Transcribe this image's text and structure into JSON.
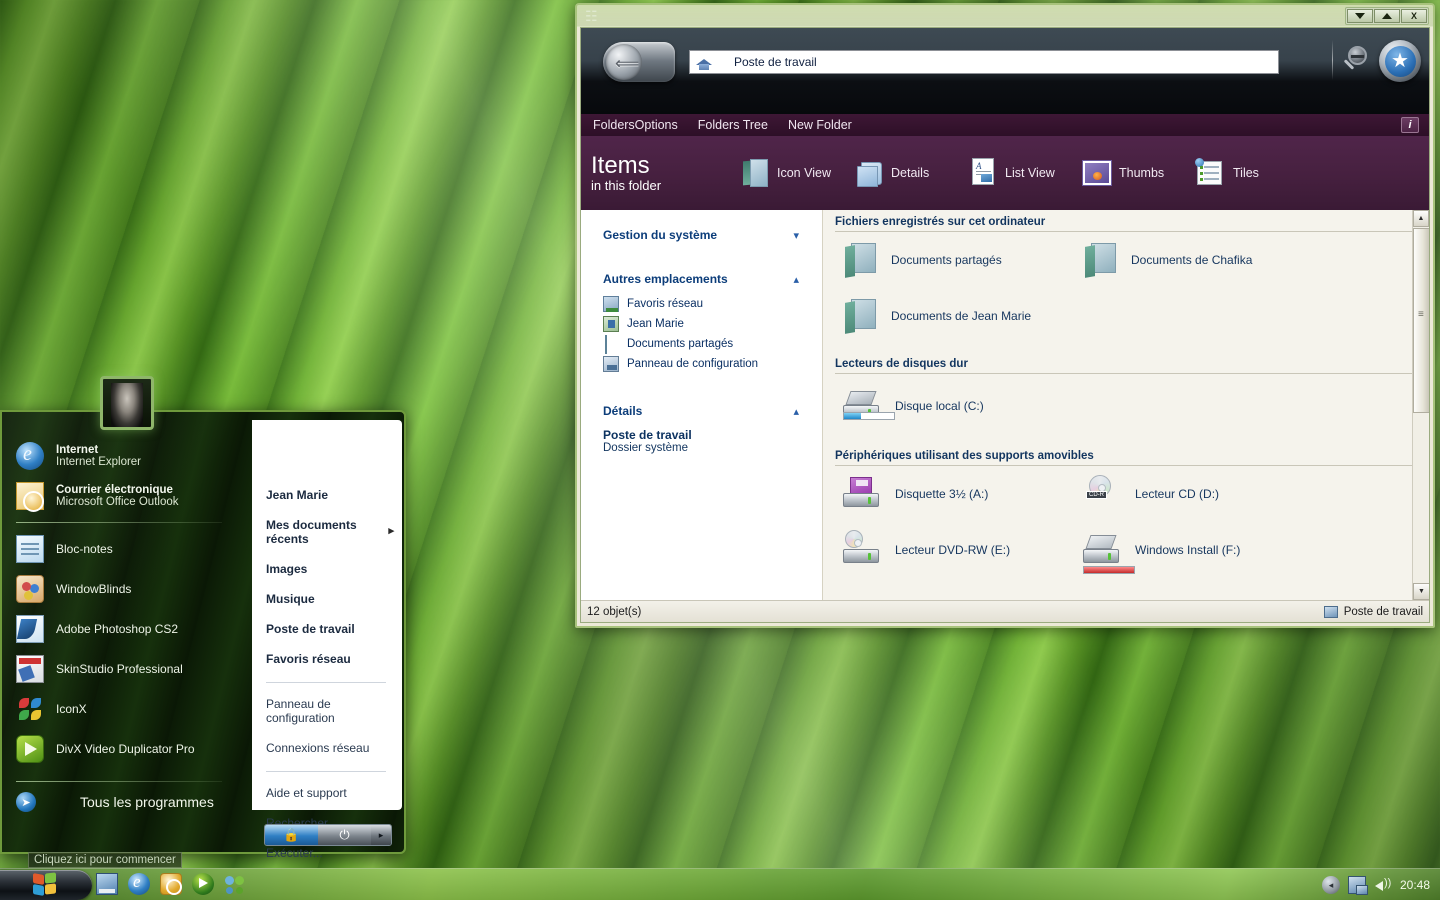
{
  "desktop": {
    "wallpaper_name": "green-grass-blades"
  },
  "explorer": {
    "window_icon": "windows-logo-icon",
    "title_buttons": [
      {
        "name": "minimize",
        "glyph": "▼"
      },
      {
        "name": "maximize",
        "glyph": "▲"
      },
      {
        "name": "close",
        "glyph": "X"
      }
    ],
    "nav": {
      "back_label": "←",
      "back_icon": "back-arrow-icon",
      "address_icon": "home-icon",
      "address_value": "Poste de travail",
      "address_placeholder": "Poste de travail",
      "search_icon": "magnifier-icon",
      "favorites_icon": "star-icon"
    },
    "menubar": {
      "items": [
        "FoldersOptions",
        "Folders Tree",
        "New Folder"
      ],
      "info_label": "i"
    },
    "viewbar": {
      "title_main": "Items",
      "title_sub": "in this folder",
      "views": [
        {
          "label": "Icon View",
          "icon": "open-folder-icon"
        },
        {
          "label": "Details",
          "icon": "folder-stack-icon"
        },
        {
          "label": "List View",
          "icon": "document-list-icon"
        },
        {
          "label": "Thumbs",
          "icon": "thumbnail-photo-icon"
        },
        {
          "label": "Tiles",
          "icon": "tiles-list-icon"
        }
      ]
    },
    "sidebar": {
      "groups": [
        {
          "title": "Gestion du système",
          "chevron": "▾",
          "expanded": false,
          "items": []
        },
        {
          "title": "Autres emplacements",
          "chevron": "▴",
          "expanded": true,
          "items": [
            {
              "label": "Favoris réseau",
              "icon": "network-places-icon"
            },
            {
              "label": "Jean Marie",
              "icon": "user-folder-icon"
            },
            {
              "label": "Documents partagés",
              "icon": "shared-documents-icon"
            },
            {
              "label": "Panneau de configuration",
              "icon": "control-panel-icon"
            }
          ]
        }
      ],
      "details": {
        "title": "Détails",
        "chevron": "▴",
        "name": "Poste de travail",
        "type": "Dossier système"
      }
    },
    "sections": [
      {
        "title": "Fichiers enregistrés sur cet ordinateur",
        "items": [
          {
            "label": "Documents partagés",
            "icon": "folder-icon"
          },
          {
            "label": "Documents de Chafika",
            "icon": "folder-icon"
          },
          {
            "label": "Documents de Jean Marie",
            "icon": "folder-icon"
          }
        ]
      },
      {
        "title": "Lecteurs de disques dur",
        "items": [
          {
            "label": "Disque local (C:)",
            "icon": "hard-drive-icon",
            "capacity_percent": 34,
            "capacity_color": "#1f87c9"
          }
        ]
      },
      {
        "title": "Périphériques utilisant des supports amovibles",
        "items": [
          {
            "label": "Disquette 3½ (A:)",
            "icon": "floppy-drive-icon"
          },
          {
            "label": "Lecteur CD (D:)",
            "icon": "cd-drive-icon",
            "badge": "CD-R"
          },
          {
            "label": "Lecteur DVD-RW (E:)",
            "icon": "dvd-drive-icon"
          },
          {
            "label": "Windows Install (F:)",
            "icon": "removable-drive-icon",
            "capacity_percent": 100,
            "capacity_color": "#c42b2b"
          }
        ]
      }
    ],
    "scrollbar": {
      "up_glyph": "▲",
      "down_glyph": "▼",
      "grip": "≡"
    },
    "statusbar": {
      "count_text": "12 objet(s)",
      "location_text": "Poste de travail",
      "location_icon": "computer-icon"
    }
  },
  "start_menu": {
    "avatar_name": "user-avatar",
    "programs": [
      {
        "title": "Internet",
        "subtitle": "Internet Explorer",
        "icon": "internet-explorer-icon"
      },
      {
        "title": "Courrier électronique",
        "subtitle": "Microsoft Office Outlook",
        "icon": "outlook-icon"
      }
    ],
    "pinned": [
      {
        "label": "Bloc-notes",
        "icon": "notepad-icon"
      },
      {
        "label": "WindowBlinds",
        "icon": "windowblinds-icon"
      },
      {
        "label": "Adobe Photoshop CS2",
        "icon": "photoshop-icon"
      },
      {
        "label": "SkinStudio Professional",
        "icon": "skinstudio-icon"
      },
      {
        "label": "IconX",
        "icon": "iconx-icon"
      },
      {
        "label": "DivX Video Duplicator Pro",
        "icon": "divx-icon"
      }
    ],
    "all_programs_label": "Tous les programmes",
    "all_programs_icon": "arrow-right-icon",
    "right_items_group1": [
      {
        "label": "Jean Marie",
        "submenu": false
      },
      {
        "label": "Mes documents récents",
        "submenu": true
      },
      {
        "label": "Images",
        "submenu": false
      },
      {
        "label": "Musique",
        "submenu": false
      },
      {
        "label": "Poste de travail",
        "submenu": false
      },
      {
        "label": "Favoris réseau",
        "submenu": false
      }
    ],
    "right_items_group2": [
      {
        "label": "Panneau de configuration"
      },
      {
        "label": "Connexions réseau"
      }
    ],
    "right_items_group3": [
      {
        "label": "Aide et support"
      },
      {
        "label": "Rechercher"
      },
      {
        "label": "Exécuter..."
      }
    ],
    "footer": {
      "lock_icon": "lock-icon",
      "lock_glyph": "▮",
      "power_icon": "power-icon",
      "power_glyph": "⏻",
      "more_icon": "chevron-right-icon",
      "more_glyph": "▸"
    }
  },
  "taskbar": {
    "start_label": "",
    "start_icon": "windows-flag-icon",
    "start_tooltip": "Cliquez ici pour commencer",
    "quick_launch": [
      {
        "name": "show-desktop-icon"
      },
      {
        "name": "internet-explorer-icon"
      },
      {
        "name": "outlook-icon"
      },
      {
        "name": "media-player-icon"
      },
      {
        "name": "msn-messenger-icon"
      }
    ],
    "tray": [
      {
        "name": "show-hidden-icons-icon",
        "glyph": "◂"
      },
      {
        "name": "network-icon"
      },
      {
        "name": "volume-icon"
      }
    ],
    "clock": "20:48"
  }
}
